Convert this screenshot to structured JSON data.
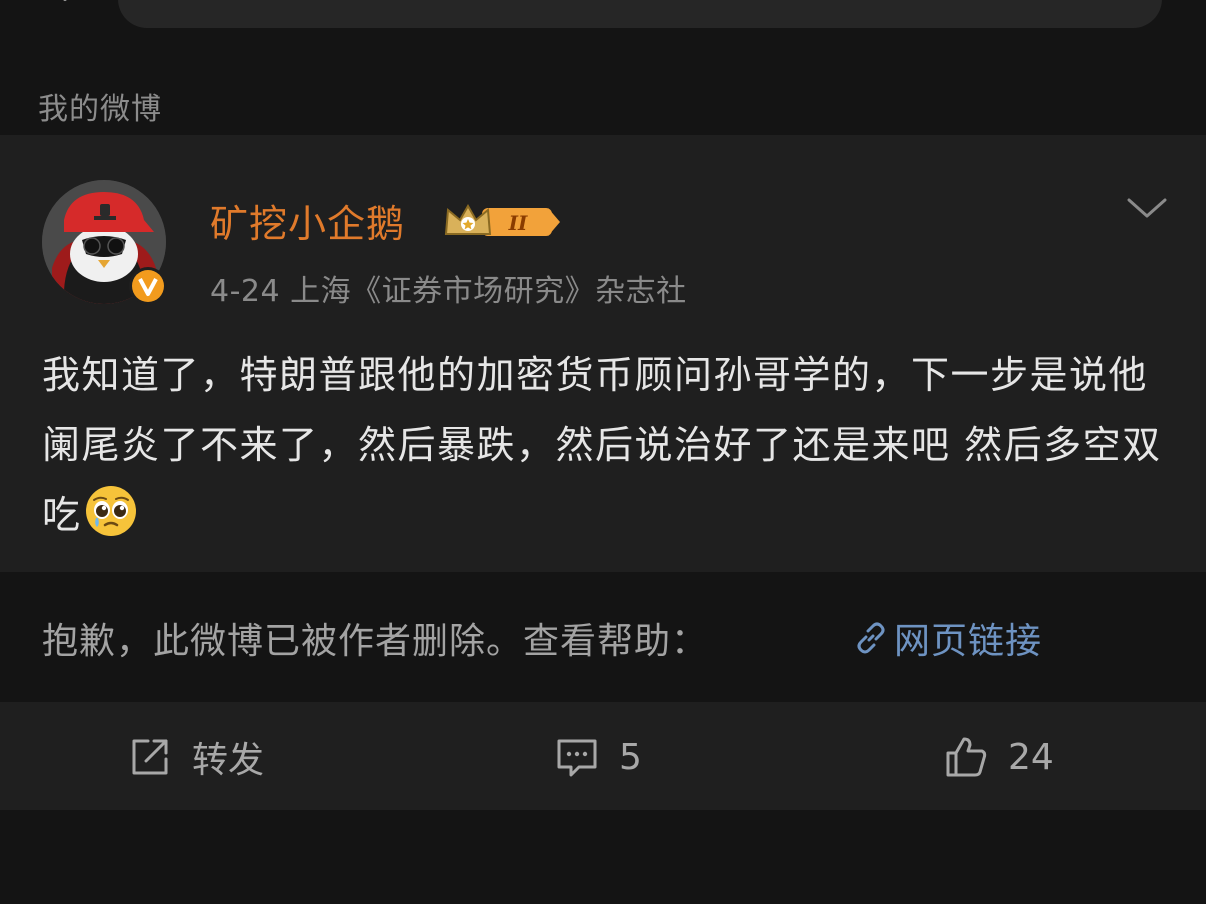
{
  "section_title": "我的微博",
  "post": {
    "username": "矿挖小企鹅",
    "level_badge": "II",
    "meta": "4-24  上海《证券市场研究》杂志社",
    "text": "我知道了，特朗普跟他的加密货币顾问孙哥学的，下一步是说他阑尾炎了不来了，然后暴跌，然后说治好了还是来吧 然后多空双吃",
    "emoji": "pleading-face-icon"
  },
  "deleted_notice": {
    "text": "抱歉，此微博已被作者删除。查看帮助：",
    "link_label": "网页链接"
  },
  "actions": {
    "repost_label": "转发",
    "comment_count": "5",
    "like_count": "24"
  },
  "colors": {
    "username": "#e07a2b",
    "link": "#6e93c2",
    "background": "#141414",
    "card": "#1f1f1f"
  }
}
